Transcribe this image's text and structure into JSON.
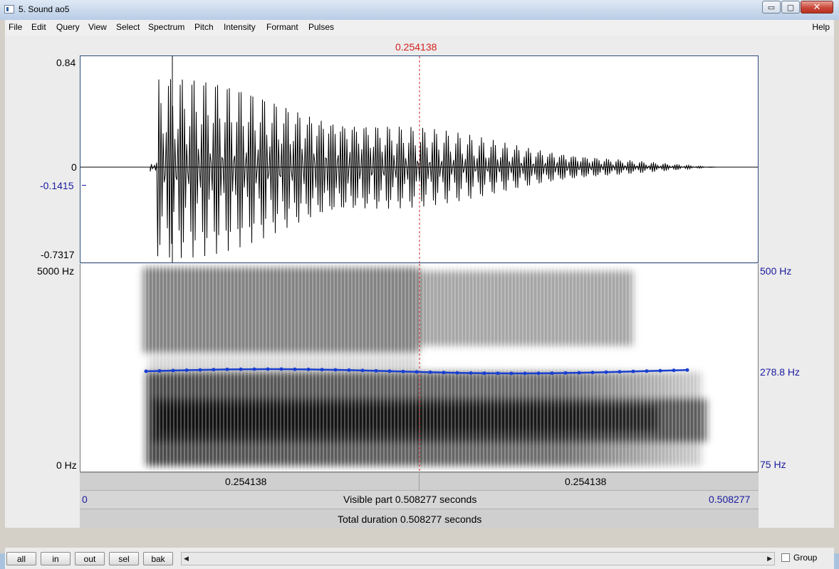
{
  "window": {
    "title": "5. Sound ao5",
    "min_glyph": "▭",
    "max_glyph": "▢",
    "close_glyph": "✕"
  },
  "menu": [
    "File",
    "Edit",
    "Query",
    "View",
    "Select",
    "Spectrum",
    "Pitch",
    "Intensity",
    "Formant",
    "Pulses"
  ],
  "menu_help": "Help",
  "cursor_time": "0.254138",
  "waveform": {
    "y_max": "0.84",
    "y_zero": "0",
    "y_cursor_value": "-0.1415",
    "y_min": "-0.7317"
  },
  "spectrogram": {
    "freq_top": "5000 Hz",
    "freq_bottom": "0 Hz",
    "pitch_top": "500 Hz",
    "pitch_current": "278.8 Hz",
    "pitch_bottom": "75 Hz"
  },
  "time_bars": {
    "left_segment": "0.254138",
    "right_segment": "0.254138",
    "visible_start": "0",
    "visible_label": "Visible part 0.508277 seconds",
    "visible_end": "0.508277",
    "total_label": "Total duration 0.508277 seconds"
  },
  "buttons": {
    "all": "all",
    "in": "in",
    "out": "out",
    "sel": "sel",
    "bak": "bak"
  },
  "group_label": "Group",
  "colors": {
    "cursor": "#d42020",
    "pitch": "#1a3fd0",
    "axis_blue": "#1a1aa0"
  }
}
